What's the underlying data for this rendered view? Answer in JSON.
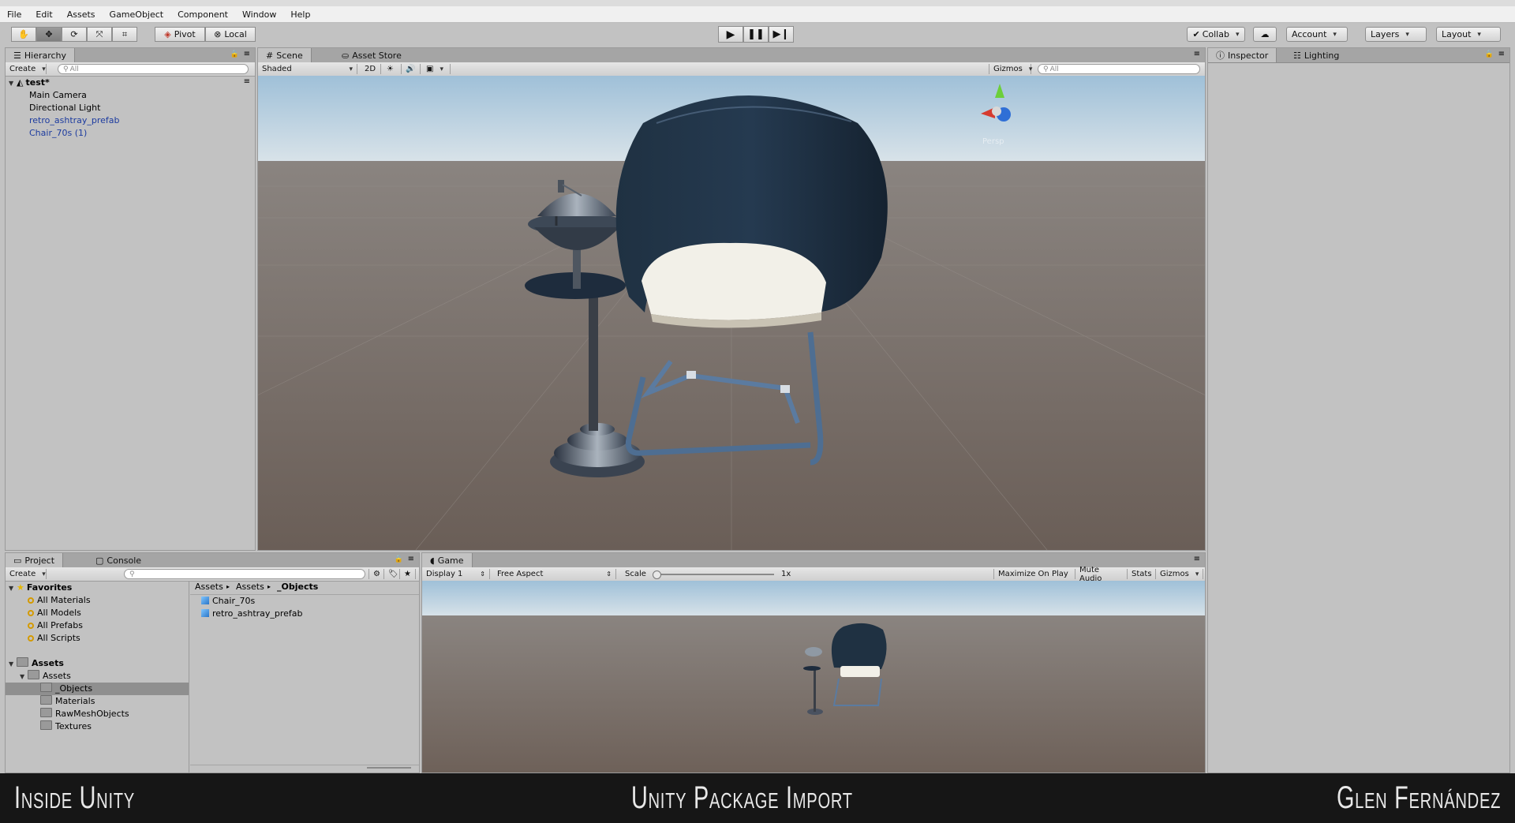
{
  "menu": [
    "File",
    "Edit",
    "Assets",
    "GameObject",
    "Component",
    "Window",
    "Help"
  ],
  "toolbar": {
    "pivot": "Pivot",
    "local": "Local",
    "collab": "Collab",
    "account": "Account",
    "layers": "Layers",
    "layout": "Layout"
  },
  "hierarchy": {
    "tab": "Hierarchy",
    "create": "Create",
    "search_placeholder": "All",
    "scene": "test*",
    "items": [
      "Main Camera",
      "Directional Light",
      "retro_ashtray_prefab",
      "Chair_70s (1)"
    ]
  },
  "scene_view": {
    "tab": "Scene",
    "asset_store_tab": "Asset Store",
    "shading": "Shaded",
    "mode_2d": "2D",
    "gizmos": "Gizmos",
    "search_placeholder": "All",
    "persp": "Persp"
  },
  "inspector": {
    "tab": "Inspector",
    "lighting_tab": "Lighting"
  },
  "project": {
    "tab": "Project",
    "console_tab": "Console",
    "create": "Create",
    "favorites_label": "Favorites",
    "favorites": [
      "All Materials",
      "All Models",
      "All Prefabs",
      "All Scripts"
    ],
    "assets_label": "Assets",
    "tree": [
      "Assets",
      "_Objects",
      "Materials",
      "RawMeshObjects",
      "Textures"
    ],
    "breadcrumb": [
      "Assets",
      "Assets",
      "_Objects"
    ],
    "files": [
      "Chair_70s",
      "retro_ashtray_prefab"
    ]
  },
  "game_view": {
    "tab": "Game",
    "display": "Display 1",
    "aspect": "Free Aspect",
    "scale_label": "Scale",
    "scale_value": "1x",
    "maximize": "Maximize On Play",
    "mute": "Mute Audio",
    "stats": "Stats",
    "gizmos": "Gizmos"
  },
  "footer": {
    "left": "Inside Unity",
    "center": "Unity Package Import",
    "right": "Glen Fernández"
  },
  "colors": {
    "prefab_text": "#1c3b9f",
    "footer_bg": "#161616",
    "panel_bg": "#c2c2c2"
  }
}
